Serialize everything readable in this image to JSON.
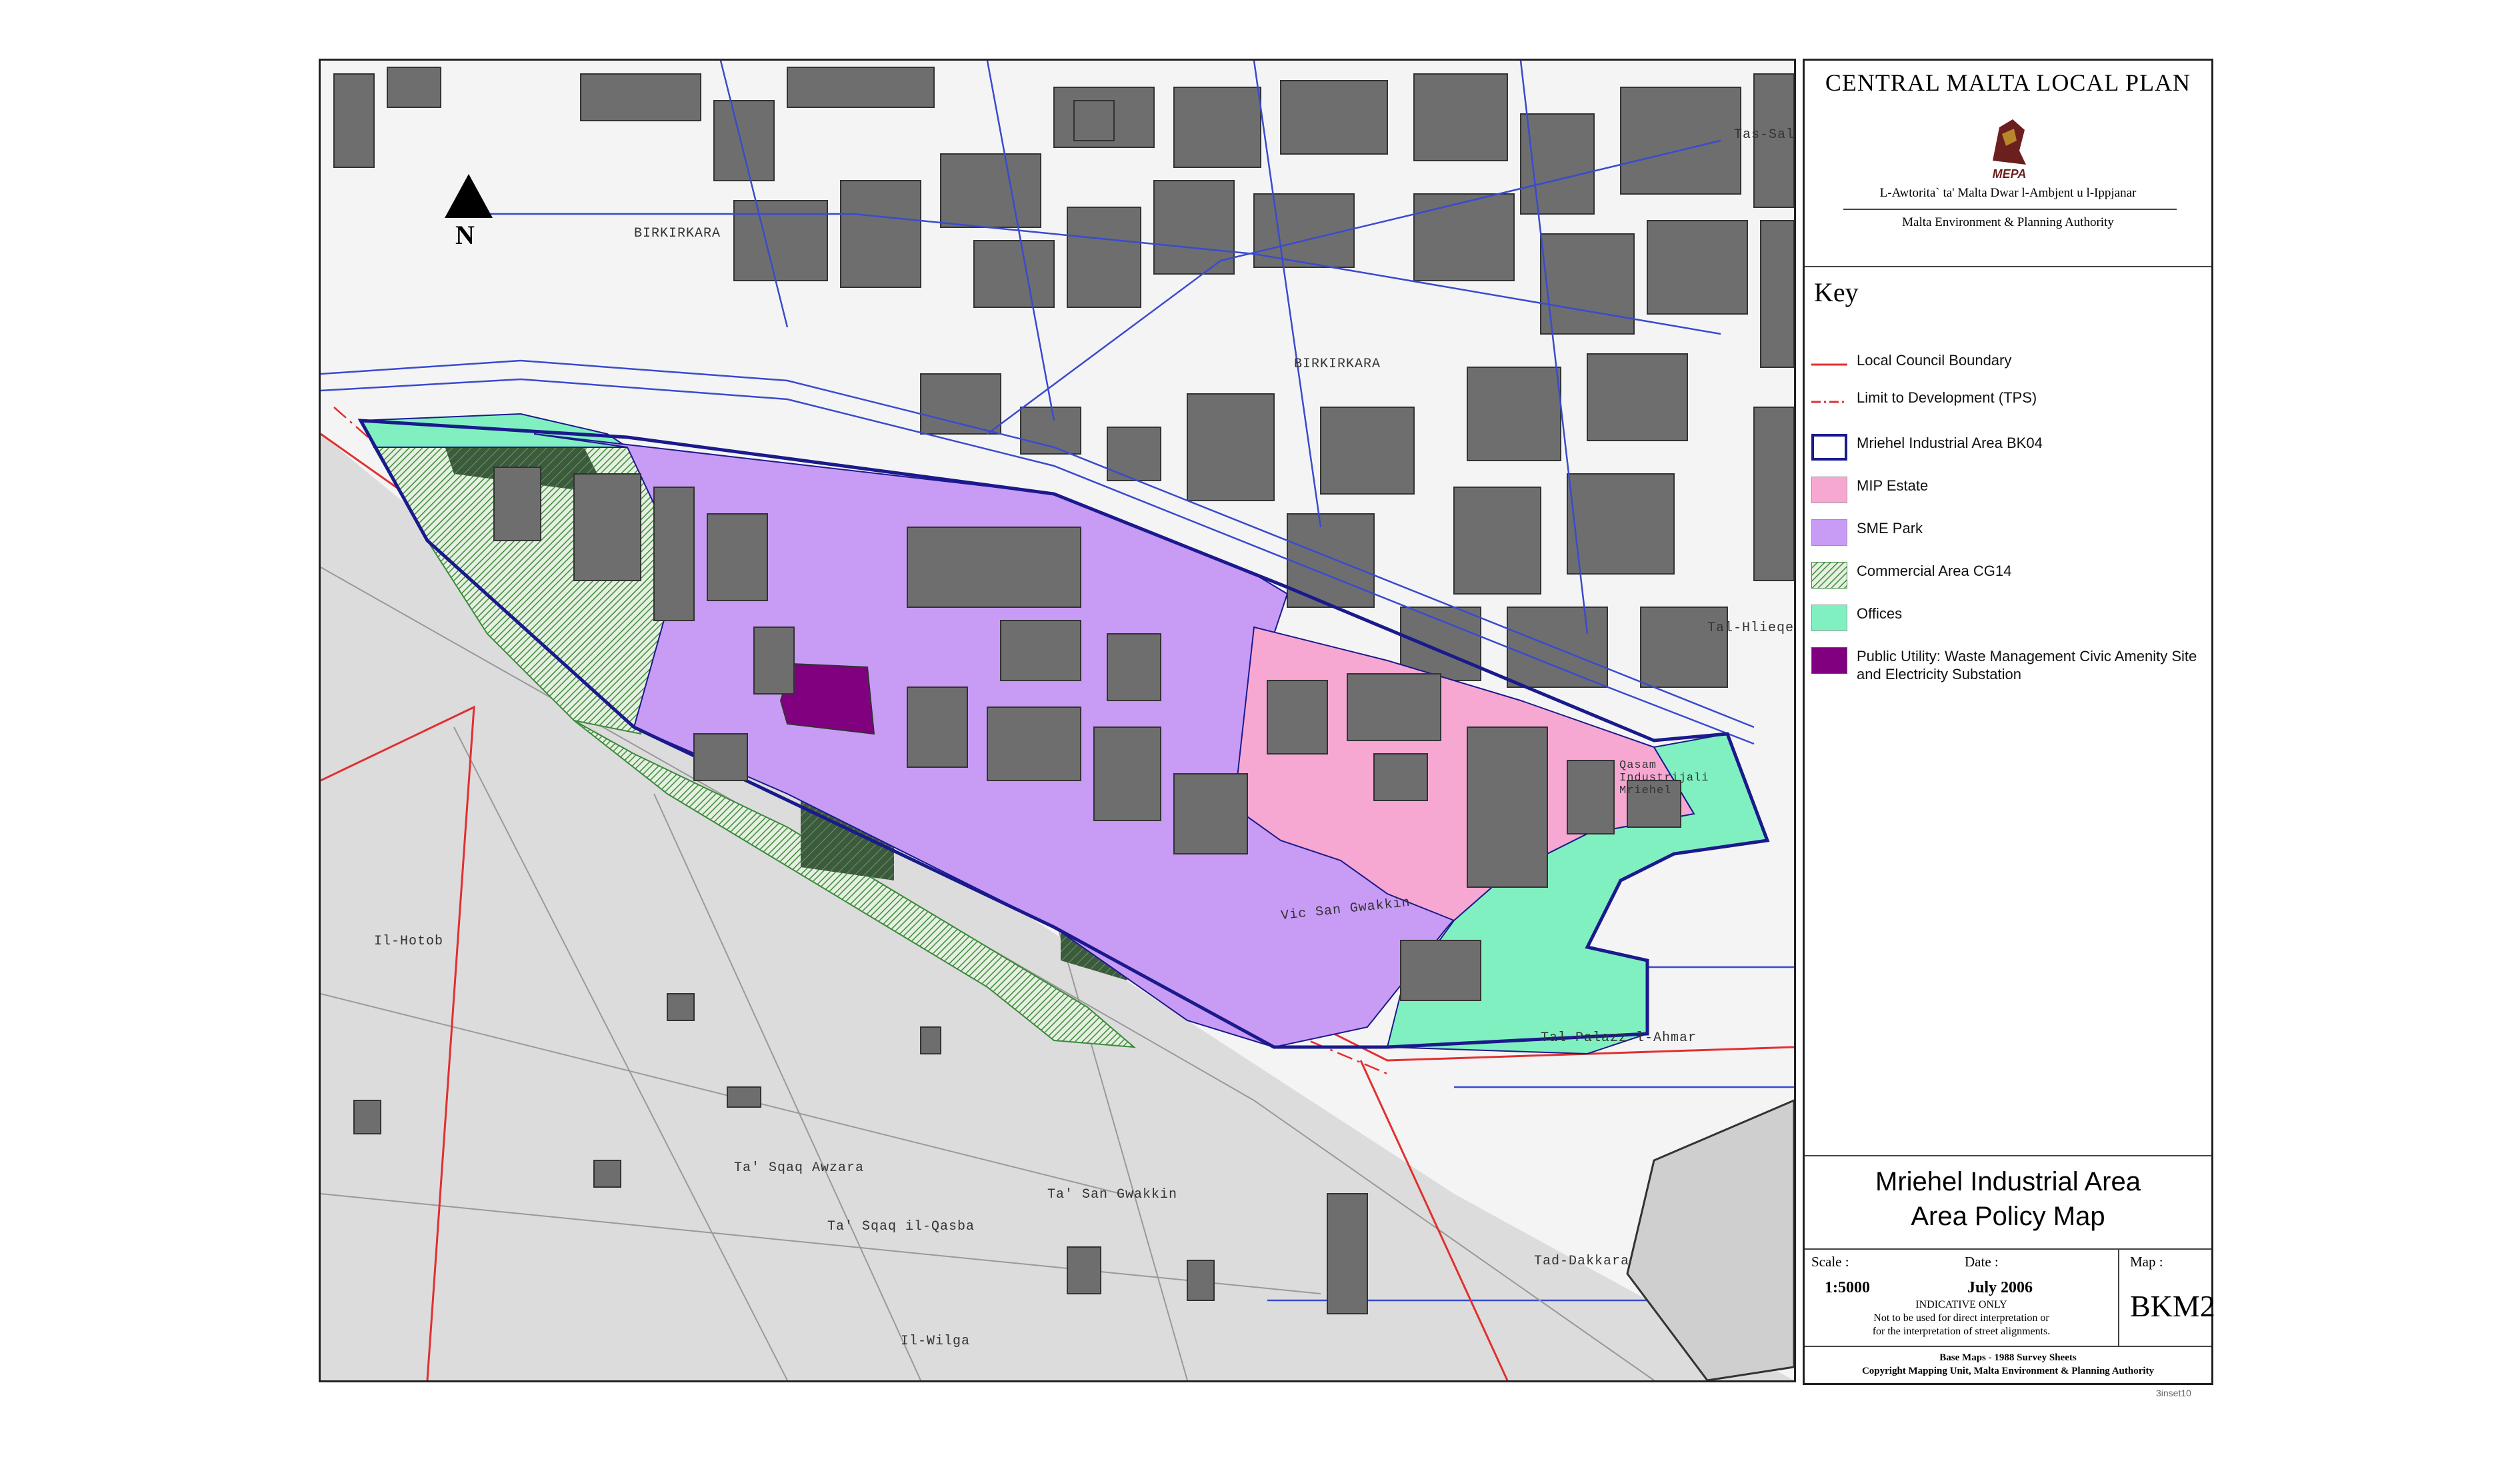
{
  "plan": {
    "title": "CENTRAL MALTA  LOCAL PLAN",
    "logo_text": "MEPA",
    "authority_maltese": "L-Awtorita` ta' Malta Dwar l-Ambjent u l-Ippjanar",
    "authority_english": "Malta Environment & Planning Authority"
  },
  "key": {
    "title": "Key",
    "items": [
      {
        "label": "Local Council Boundary",
        "swatch": "red-line",
        "color": "#e03030"
      },
      {
        "label": "Limit to Development (TPS)",
        "swatch": "red-dashdot-line",
        "color": "#e03030"
      },
      {
        "label": "Mriehel Industrial Area BK04",
        "swatch": "outline",
        "color": "#1a1a8c"
      },
      {
        "label": "MIP Estate",
        "swatch": "fill",
        "color": "#f7a8d2"
      },
      {
        "label": "SME Park",
        "swatch": "fill",
        "color": "#c89bf5"
      },
      {
        "label": "Commercial Area CG14",
        "swatch": "hatch",
        "color": "#3a8a3a"
      },
      {
        "label": "Offices",
        "swatch": "fill",
        "color": "#80f0c0"
      },
      {
        "label": "Public Utility: Waste Management Civic Amenity Site and Electricity Substation",
        "swatch": "fill",
        "color": "#800080"
      }
    ]
  },
  "map_title": {
    "line1": "Mriehel Industrial Area",
    "line2": "Area Policy Map"
  },
  "info": {
    "scale_label": "Scale :",
    "scale_value": "1:5000",
    "date_label": "Date :",
    "date_value": "July 2006",
    "map_label": "Map :",
    "map_value": "BKM2",
    "note1": "INDICATIVE ONLY",
    "note2": "Not to be used for direct interpretation or",
    "note3": "for the interpretation of street alignments."
  },
  "footer": {
    "line1": "Base Maps - 1988 Survey Sheets",
    "line2": "Copyright Mapping Unit, Malta Environment & Planning Authority"
  },
  "sheet_ref": "3inset10",
  "map": {
    "north": "N",
    "places": {
      "birkirkara_1": "BIRKIRKARA",
      "birkirkara_2": "BIRKIRKARA",
      "san_gwakkin": "Vic San Gwakkin",
      "qasam": "Qasam Industrijali Mriehel",
      "tal_palazz": "Tal-Palazz l-Ahmar",
      "il_hotob": "Il-Hotob",
      "tas_sqaq_awzara": "Ta' Sqaq Awzara",
      "ta_san_gwakkin": "Ta' San Gwakkin",
      "tas_sqaq_il_qasba": "Ta' Sqaq il-Qasba",
      "il_wilga": "Il-Wilga",
      "tad_dakkara": "Tad-Dakkara",
      "tas_salib": "Tas-Salib",
      "tal_hlieqex": "Tal-Hlieqex"
    }
  }
}
